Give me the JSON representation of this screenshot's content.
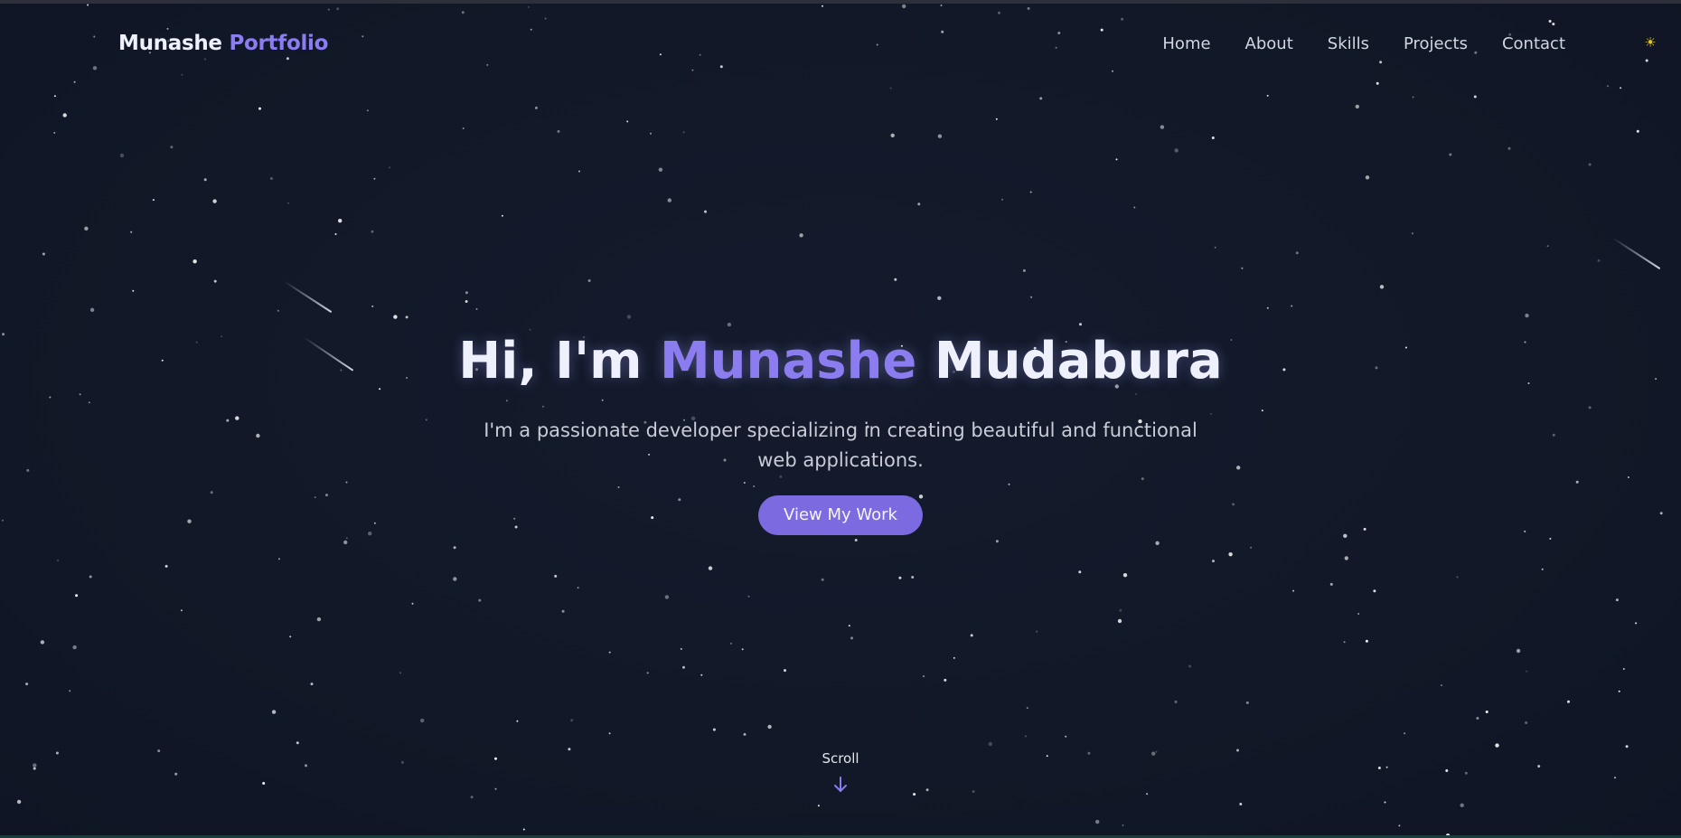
{
  "brand": {
    "first": "Munashe",
    "second": "Portfolio"
  },
  "nav": {
    "items": [
      {
        "label": "Home"
      },
      {
        "label": "About"
      },
      {
        "label": "Skills"
      },
      {
        "label": "Projects"
      },
      {
        "label": "Contact"
      }
    ],
    "theme_icon": "sun-icon"
  },
  "hero": {
    "greeting": "Hi, I'm",
    "first_name": "Munashe",
    "last_name": "Mudabura",
    "subtitle": "I'm a passionate developer specializing in creating beautiful and functional web applications.",
    "cta_label": "View My Work"
  },
  "scroll": {
    "label": "Scroll",
    "icon": "arrow-down-icon"
  },
  "colors": {
    "background": "#111827",
    "accent": "#8b7cf0",
    "button": "#7c6be0",
    "sun": "#e3c316",
    "text": "#eef0fb"
  }
}
